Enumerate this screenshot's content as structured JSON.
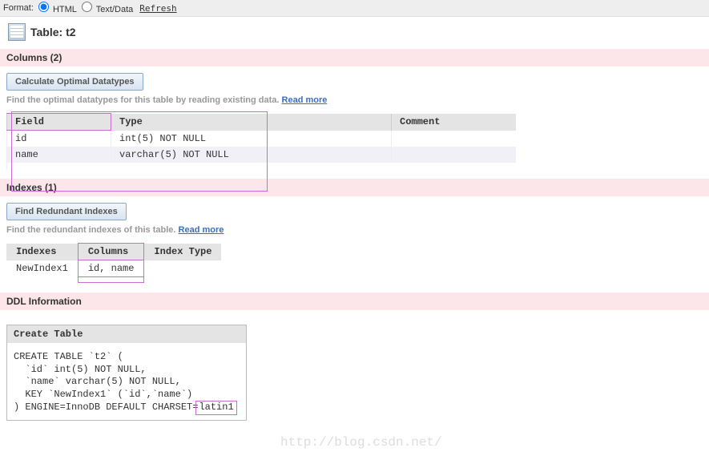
{
  "format_bar": {
    "label": "Format:",
    "opt_html": "HTML",
    "opt_text": "Text/Data",
    "refresh": "Refresh"
  },
  "title": {
    "label": "Table:",
    "name": "t2"
  },
  "sections": {
    "columns_hdr": "Columns (2)",
    "indexes_hdr": "Indexes (1)",
    "ddl_hdr": "DDL Information"
  },
  "columns": {
    "btn": "Calculate Optimal Datatypes",
    "hint_text": "Find the optimal datatypes for this table by reading existing data.",
    "read_more": "Read more",
    "headers": {
      "field": "Field",
      "type": "Type",
      "comment": "Comment"
    },
    "rows": [
      {
        "field": "id",
        "type": "int(5) NOT NULL",
        "comment": ""
      },
      {
        "field": "name",
        "type": "varchar(5) NOT NULL",
        "comment": ""
      }
    ]
  },
  "indexes": {
    "btn": "Find Redundant Indexes",
    "hint_text": "Find the redundant indexes of this table.",
    "read_more": "Read more",
    "headers": {
      "idx": "Indexes",
      "cols": "Columns",
      "itype": "Index Type"
    },
    "row": {
      "idx": "NewIndex1",
      "cols": "id, name",
      "itype": ""
    }
  },
  "ddl": {
    "head": "Create Table",
    "body_pre": "CREATE TABLE `t2` (\n  `id` int(5) NOT NULL,\n  `name` varchar(5) NOT NULL,\n  KEY `NewIndex1` (`id`,`name`)\n) ENGINE=InnoDB DEFAULT CHARSET=",
    "charset": "latin1"
  },
  "watermark": "http://blog.csdn.net/"
}
